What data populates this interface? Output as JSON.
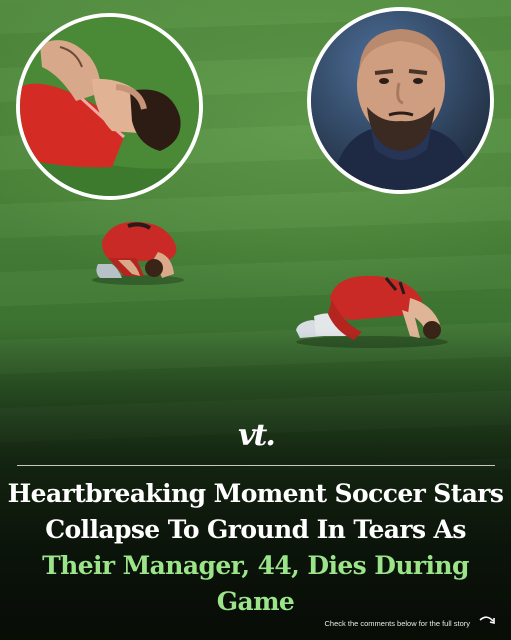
{
  "brand": {
    "logo_text": "vt."
  },
  "headline": {
    "line1": "Heartbreaking Moment Soccer Stars",
    "line2": "Collapse To Ground In Tears As",
    "line3": "Their Manager, 44, Dies During Game"
  },
  "footer": {
    "cta_text": "Check the comments below for the full story"
  },
  "colors": {
    "accent_green": "#9be489",
    "pitch_green": "#4f8a3c",
    "kit_red": "#c92a25",
    "text_white": "#ffffff"
  },
  "icons": {
    "cta_icon": "curved-arrow-icon"
  }
}
